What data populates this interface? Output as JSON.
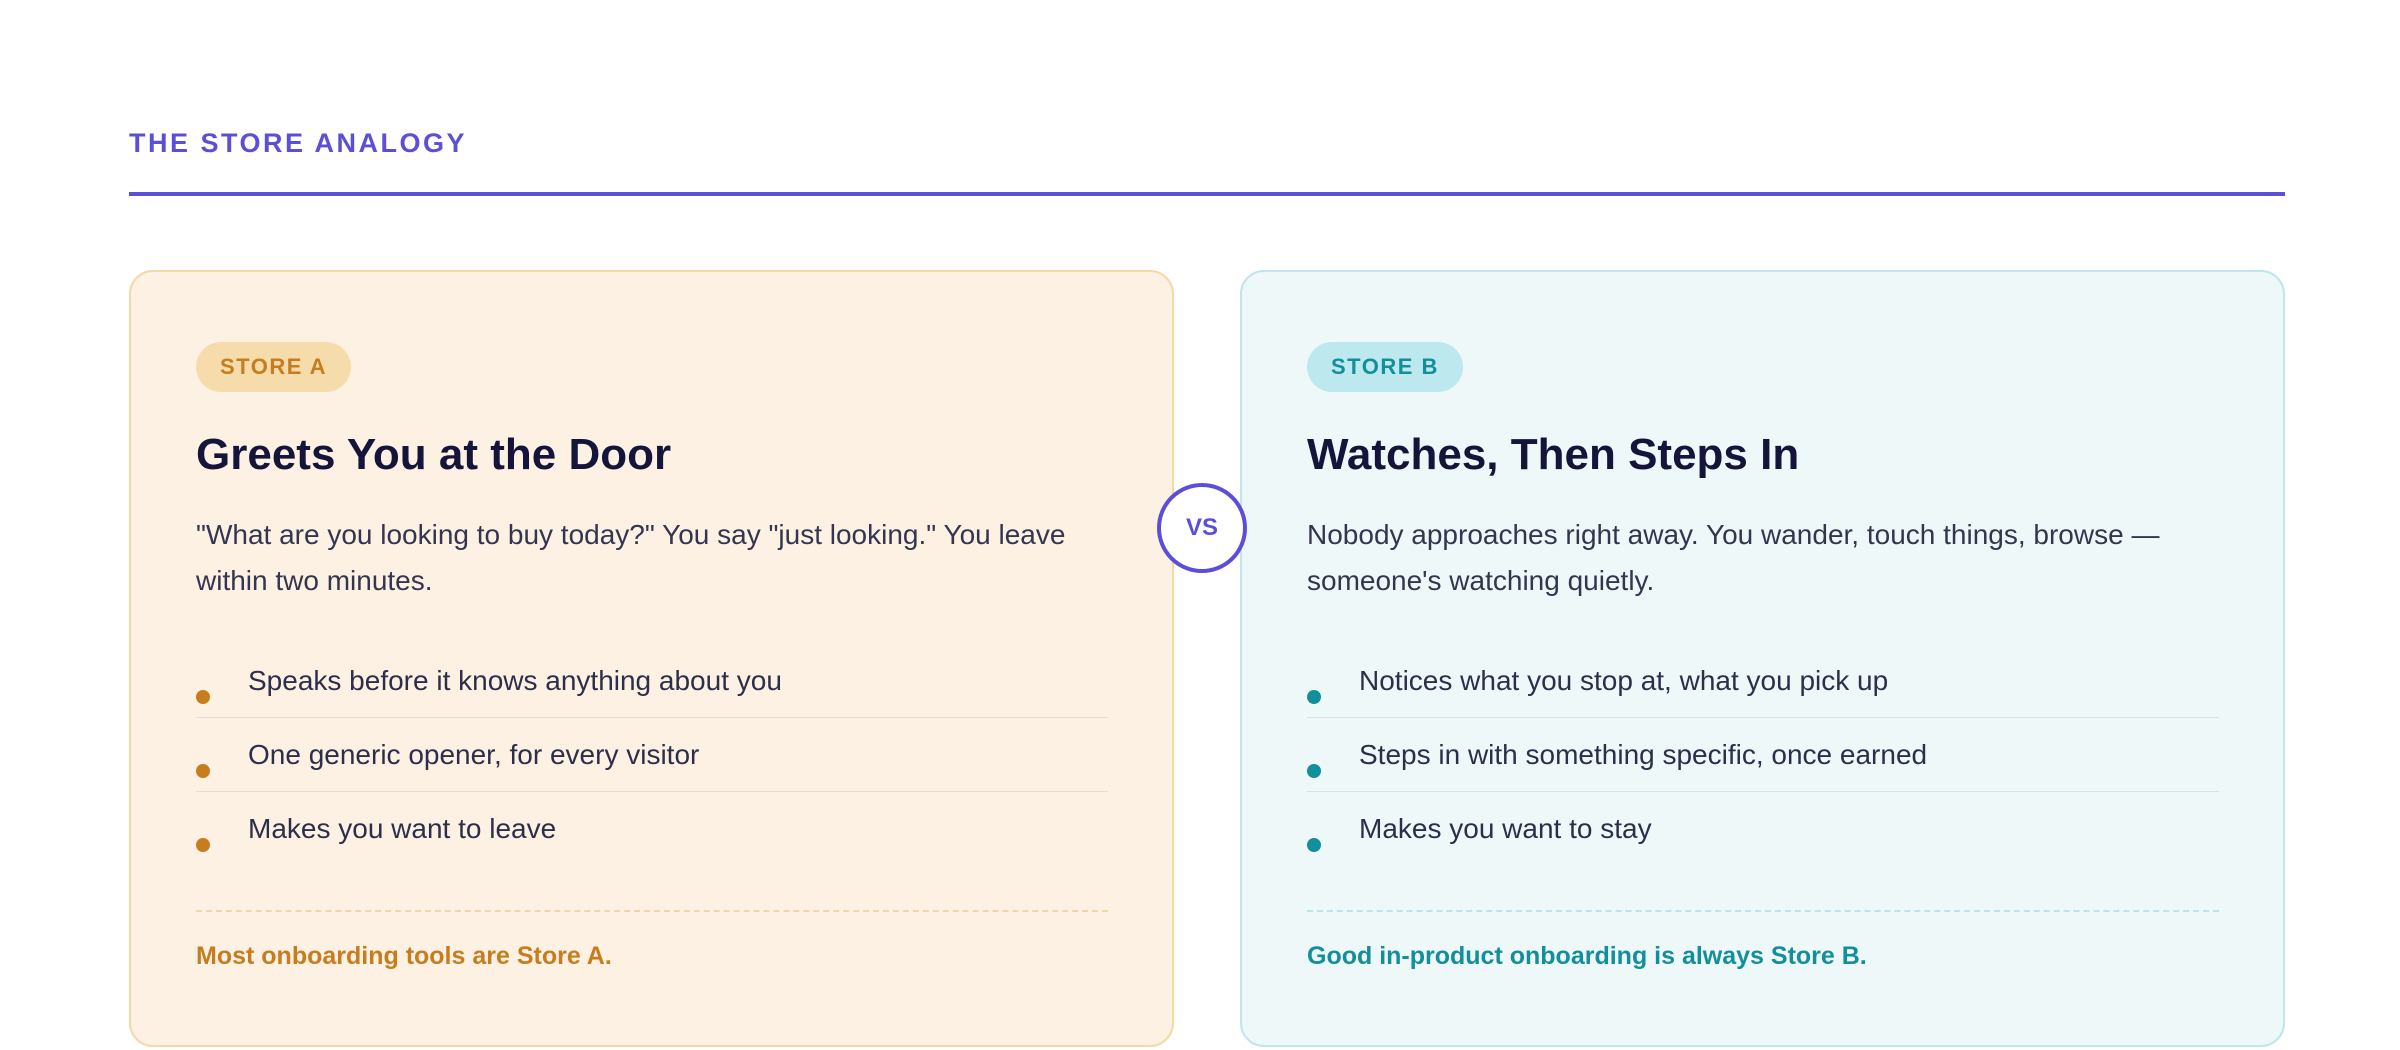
{
  "section": {
    "eyebrow": "THE STORE ANALOGY"
  },
  "colors": {
    "accent": "#5b4fd9",
    "store_a": "#c77d1e",
    "store_b": "#138f9c"
  },
  "vs_label": "VS",
  "store_a": {
    "badge": "STORE A",
    "title": "Greets You at the Door",
    "description": "\"What are you looking to buy today?\" You say \"just looking.\" You leave within two minutes.",
    "bullets": [
      "Speaks before it knows anything about you",
      "One generic opener, for every visitor",
      "Makes you want to leave"
    ],
    "footer": "Most onboarding tools are Store A."
  },
  "store_b": {
    "badge": "STORE B",
    "title": "Watches, Then Steps In",
    "description": "Nobody approaches right away. You wander, touch things, browse — someone's watching quietly.",
    "bullets": [
      "Notices what you stop at, what you pick up",
      "Steps in with something specific, once earned",
      "Makes you want to stay"
    ],
    "footer": "Good in-product onboarding is always Store B."
  }
}
